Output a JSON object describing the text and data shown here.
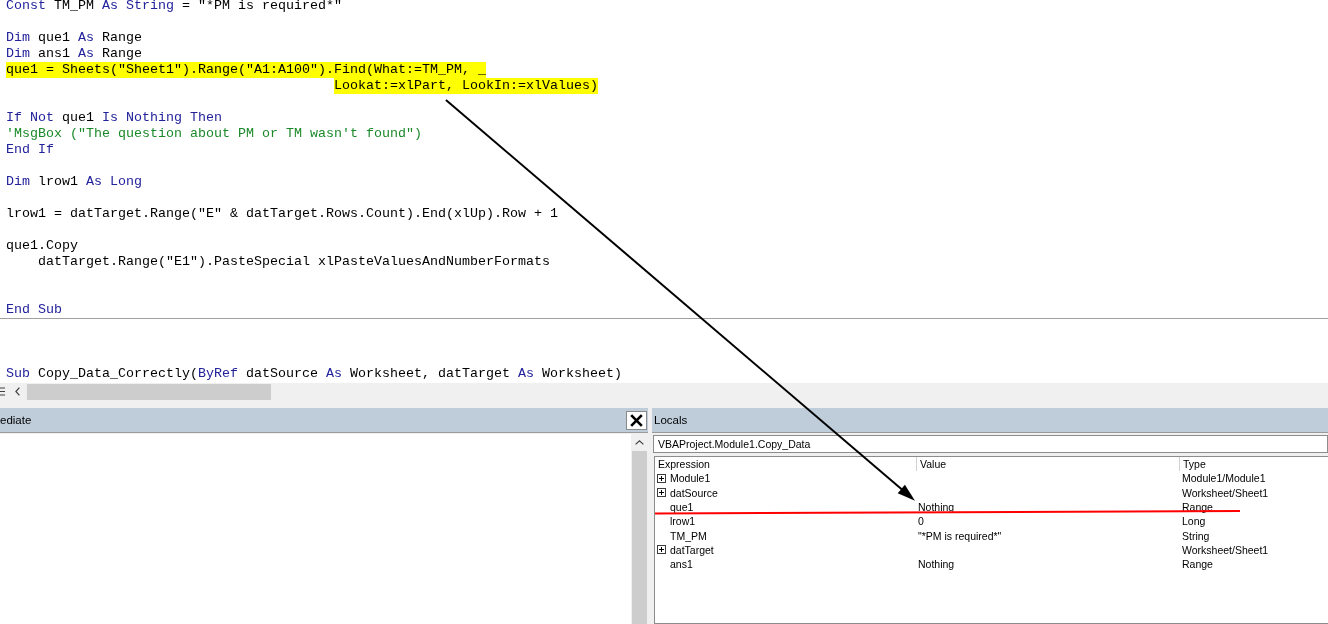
{
  "code_pane": {
    "lines": [
      {
        "kind": "code",
        "highlighted": false,
        "tokens": [
          {
            "kind": "keyword",
            "text": "Const"
          },
          {
            "kind": "plain",
            "text": " TM_PM "
          },
          {
            "kind": "keyword",
            "text": "As String"
          },
          {
            "kind": "plain",
            "text": " = \"*PM is required*\""
          }
        ]
      },
      {
        "kind": "blank"
      },
      {
        "kind": "code",
        "highlighted": false,
        "tokens": [
          {
            "kind": "keyword",
            "text": "Dim"
          },
          {
            "kind": "plain",
            "text": " que1 "
          },
          {
            "kind": "keyword",
            "text": "As"
          },
          {
            "kind": "plain",
            "text": " Range"
          }
        ]
      },
      {
        "kind": "code",
        "highlighted": false,
        "tokens": [
          {
            "kind": "keyword",
            "text": "Dim"
          },
          {
            "kind": "plain",
            "text": " ans1 "
          },
          {
            "kind": "keyword",
            "text": "As"
          },
          {
            "kind": "plain",
            "text": " Range"
          }
        ]
      },
      {
        "kind": "code",
        "highlighted": true,
        "tokens": [
          {
            "kind": "plain",
            "text": "que1 = Sheets(\"Sheet1\").Range(\"A1:A100\").Find(What:=TM_PM, _"
          }
        ]
      },
      {
        "kind": "code",
        "highlighted": true,
        "tokens": [
          {
            "kind": "plain",
            "text": "                                         Lookat:=xlPart, LookIn:=xlValues)"
          }
        ]
      },
      {
        "kind": "blank"
      },
      {
        "kind": "code",
        "highlighted": false,
        "tokens": [
          {
            "kind": "keyword",
            "text": "If Not"
          },
          {
            "kind": "plain",
            "text": " que1 "
          },
          {
            "kind": "keyword",
            "text": "Is Nothing Then"
          }
        ]
      },
      {
        "kind": "code",
        "highlighted": false,
        "tokens": [
          {
            "kind": "comment",
            "text": "'MsgBox (\"The question about PM or TM wasn't found\")"
          }
        ]
      },
      {
        "kind": "code",
        "highlighted": false,
        "tokens": [
          {
            "kind": "keyword",
            "text": "End If"
          }
        ]
      },
      {
        "kind": "blank"
      },
      {
        "kind": "code",
        "highlighted": false,
        "tokens": [
          {
            "kind": "keyword",
            "text": "Dim"
          },
          {
            "kind": "plain",
            "text": " lrow1 "
          },
          {
            "kind": "keyword",
            "text": "As Long"
          }
        ]
      },
      {
        "kind": "blank"
      },
      {
        "kind": "code",
        "highlighted": false,
        "tokens": [
          {
            "kind": "plain",
            "text": "lrow1 = datTarget.Range(\"E\" & datTarget.Rows.Count).End(xlUp).Row + 1"
          }
        ]
      },
      {
        "kind": "blank"
      },
      {
        "kind": "code",
        "highlighted": false,
        "tokens": [
          {
            "kind": "plain",
            "text": "que1.Copy"
          }
        ]
      },
      {
        "kind": "code",
        "highlighted": false,
        "tokens": [
          {
            "kind": "plain",
            "text": "    datTarget.Range(\"E1\").PasteSpecial xlPasteValuesAndNumberFormats"
          }
        ]
      },
      {
        "kind": "blank"
      },
      {
        "kind": "blank"
      },
      {
        "kind": "code",
        "highlighted": false,
        "tokens": [
          {
            "kind": "keyword",
            "text": "End Sub"
          }
        ]
      },
      {
        "kind": "separator"
      },
      {
        "kind": "blank"
      },
      {
        "kind": "blank"
      },
      {
        "kind": "blank"
      },
      {
        "kind": "code",
        "highlighted": false,
        "tokens": [
          {
            "kind": "keyword",
            "text": "Sub"
          },
          {
            "kind": "plain",
            "text": " Copy_Data_Correctly("
          },
          {
            "kind": "keyword",
            "text": "ByRef"
          },
          {
            "kind": "plain",
            "text": " datSource "
          },
          {
            "kind": "keyword",
            "text": "As"
          },
          {
            "kind": "plain",
            "text": " Worksheet, datTarget "
          },
          {
            "kind": "keyword",
            "text": "As"
          },
          {
            "kind": "plain",
            "text": " Worksheet)"
          }
        ]
      }
    ]
  },
  "immediate": {
    "title": "ediate"
  },
  "locals": {
    "title": "Locals",
    "context": "VBAProject.Module1.Copy_Data",
    "columns": [
      "Expression",
      "Value",
      "Type"
    ],
    "rows": [
      {
        "expression": "Module1",
        "type": "Module1/Module1",
        "expandable": true,
        "underlined": false
      },
      {
        "expression": "datSource",
        "type": "Worksheet/Sheet1",
        "expandable": true,
        "underlined": false
      },
      {
        "expression": "que1",
        "value": "Nothing",
        "type": "Range",
        "expandable": false,
        "underlined": true
      },
      {
        "expression": "lrow1",
        "value": "0",
        "type": "Long",
        "expandable": false,
        "underlined": false
      },
      {
        "expression": "TM_PM",
        "value": "\"*PM is required*\"",
        "type": "String",
        "expandable": false,
        "underlined": false
      },
      {
        "expression": "datTarget",
        "type": "Worksheet/Sheet1",
        "expandable": true,
        "underlined": false
      },
      {
        "expression": "ans1",
        "value": "Nothing",
        "type": "Range",
        "expandable": false,
        "underlined": false
      }
    ]
  },
  "arrow": true
}
